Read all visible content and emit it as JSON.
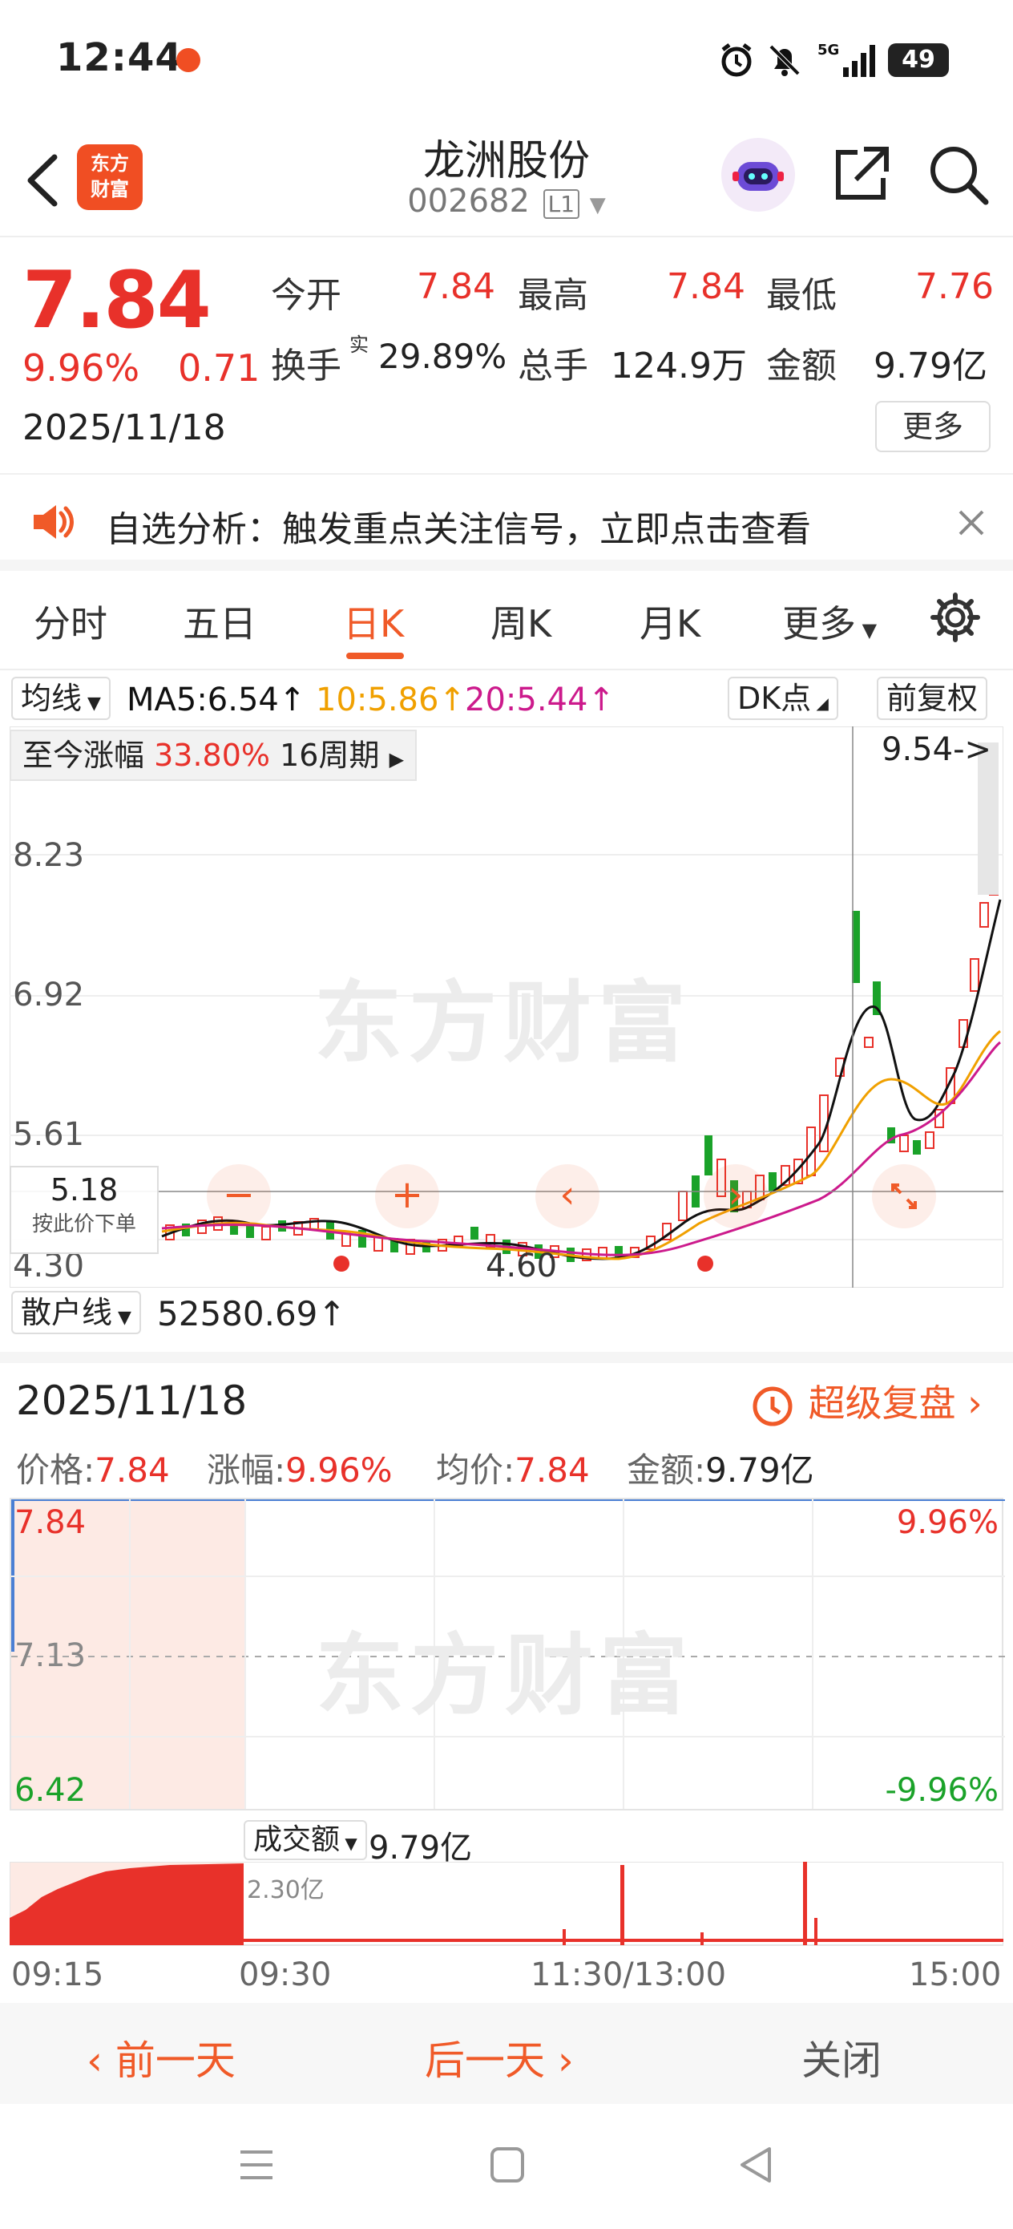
{
  "status_bar": {
    "time": "12:44",
    "battery": "49",
    "network": "5G"
  },
  "header": {
    "title": "龙洲股份",
    "code": "002682",
    "level_badge": "L1",
    "logo_text_line1": "东方",
    "logo_text_line2": "财富"
  },
  "quote": {
    "price": "7.84",
    "change_pct": "9.96%",
    "change": "0.71",
    "date": "2025/11/18",
    "open_label": "今开",
    "open": "7.84",
    "high_label": "最高",
    "high": "7.84",
    "low_label": "最低",
    "low": "7.76",
    "turnover_label": "换手",
    "turnover_sup": "实",
    "turnover": "29.89%",
    "volume_label": "总手",
    "volume": "124.9万",
    "amount_label": "金额",
    "amount": "9.79亿",
    "more_label": "更多"
  },
  "notice": {
    "text": "自选分析：触发重点关注信号，立即点击查看"
  },
  "tabs": [
    {
      "label": "分时"
    },
    {
      "label": "五日"
    },
    {
      "label": "日K"
    },
    {
      "label": "周K"
    },
    {
      "label": "月K"
    },
    {
      "label": "更多"
    }
  ],
  "active_tab": "日K",
  "ma_bar": {
    "selector": "均线",
    "ma5": "MA5:6.54↑",
    "ma10": "10:5.86↑",
    "ma20": "20:5.44↑",
    "dk_label": "DK点",
    "adjust_label": "前复权"
  },
  "kchart": {
    "period_label": "至今涨幅",
    "period_pct": "33.80%",
    "period_count": "16周期",
    "high_marker": "9.54->",
    "low_marker": "4.60",
    "crosshair_price": "5.18",
    "crosshair_hint": "按此价下单",
    "y_labels": [
      "8.23",
      "6.92",
      "5.61",
      "4.30"
    ],
    "watermark": "东方财富",
    "sub_indicator": "散户线",
    "sub_value": "52580.69↑",
    "colors": {
      "up": "#e8312a",
      "down": "#1aa229",
      "ma5": "#111111",
      "ma10": "#f0a000",
      "ma20": "#cc1a8c"
    }
  },
  "detail": {
    "date": "2025/11/18",
    "replay_label": "超级复盘",
    "price_label": "价格:",
    "price": "7.84",
    "pct_label": "涨幅:",
    "pct": "9.96%",
    "avg_label": "均价:",
    "avg": "7.84",
    "amt_label": "金额:",
    "amt": "9.79亿",
    "top_price": "7.84",
    "mid_price": "7.13",
    "bottom_price": "6.42",
    "top_pct": "9.96%",
    "bottom_pct": "-9.96%",
    "vol_selector": "成交额",
    "vol_value": "9.79亿",
    "vol_scale": "2.30亿",
    "times": [
      "09:15",
      "09:30",
      "11:30/13:00",
      "15:00"
    ],
    "watermark": "东方财富"
  },
  "bottom_actions": {
    "prev": "前一天",
    "next": "后一天",
    "close": "关闭"
  }
}
